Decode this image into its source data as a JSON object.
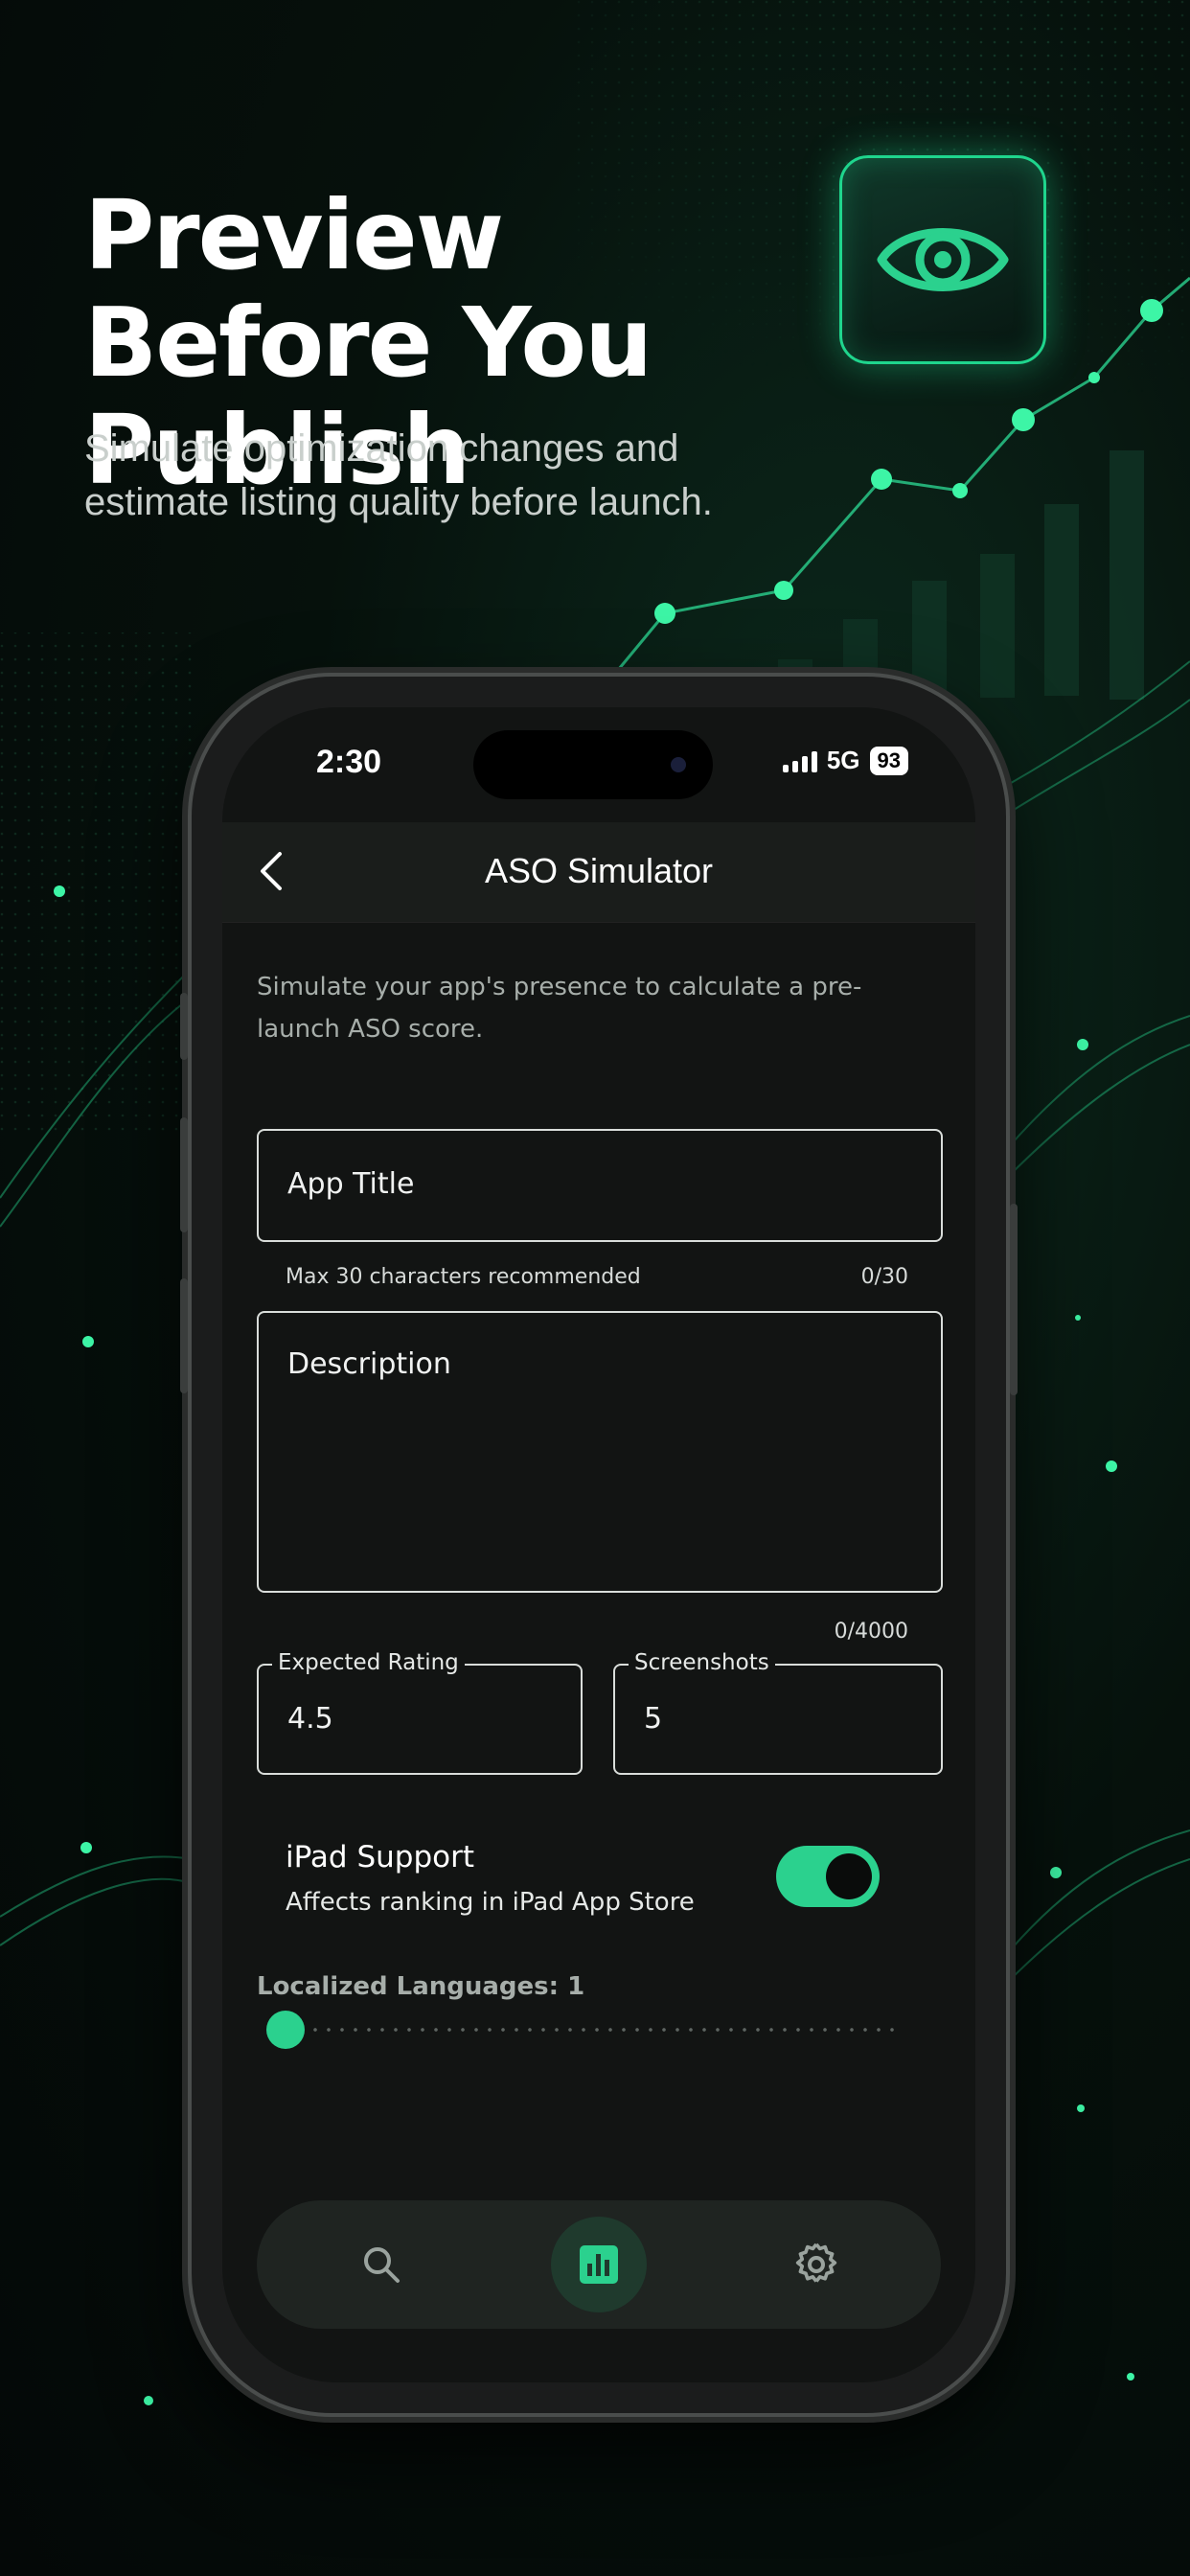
{
  "hero": {
    "title": "Preview Before You Publish",
    "subtitle": "Simulate optimization changes and estimate listing quality before launch.",
    "badge_icon": "eye-icon"
  },
  "status_bar": {
    "time": "2:30",
    "network": "5G",
    "battery": "93"
  },
  "nav": {
    "back_icon": "chevron-left-icon",
    "title": "ASO Simulator"
  },
  "form": {
    "intro": "Simulate your app's presence to calculate a pre-launch ASO score.",
    "app_title": {
      "label": "App Title",
      "helper": "Max 30 characters recommended",
      "counter": "0/30"
    },
    "description": {
      "label": "Description",
      "counter": "0/4000"
    },
    "expected_rating": {
      "label": "Expected Rating",
      "value": "4.5"
    },
    "screenshots": {
      "label": "Screenshots",
      "value": "5"
    },
    "ipad_support": {
      "title": "iPad Support",
      "subtitle": "Affects ranking in iPad App Store",
      "enabled": true
    },
    "localized_languages": {
      "label": "Localized Languages: 1",
      "value": 1
    }
  },
  "tabbar": {
    "items": [
      {
        "icon": "search-icon",
        "active": false
      },
      {
        "icon": "bar-chart-icon",
        "active": true
      },
      {
        "icon": "gear-icon",
        "active": false
      }
    ]
  },
  "colors": {
    "accent": "#2bd18e",
    "background": "#040807",
    "screen": "#121413"
  }
}
